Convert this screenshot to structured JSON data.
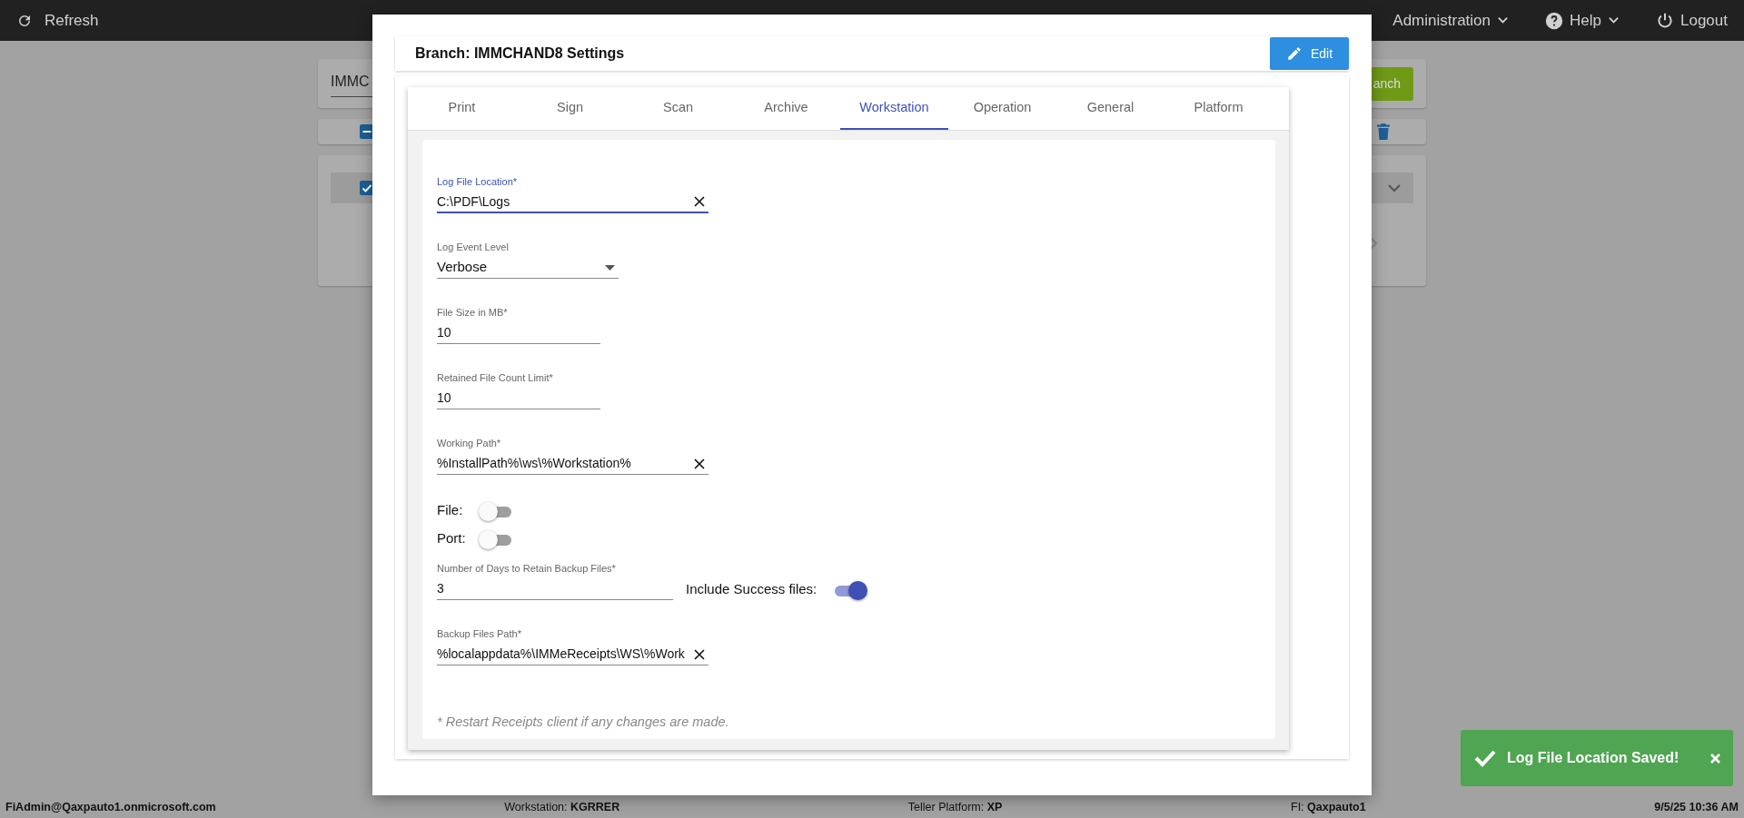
{
  "topbar": {
    "refresh": "Refresh",
    "menus": [
      {
        "kind": "dropdown",
        "label": "Administration"
      },
      {
        "kind": "help",
        "label": "Help"
      },
      {
        "kind": "logout",
        "label": "Logout"
      }
    ]
  },
  "background": {
    "search_value": "IMMC",
    "button": "anch",
    "header_checked": true,
    "row_checked": true
  },
  "modal": {
    "title": "Branch: IMMCHAND8 Settings",
    "edit": "Edit",
    "tabs": [
      {
        "label": "Print",
        "selected": false
      },
      {
        "label": "Sign",
        "selected": false
      },
      {
        "label": "Scan",
        "selected": false
      },
      {
        "label": "Archive",
        "selected": false
      },
      {
        "label": "Workstation",
        "selected": true
      },
      {
        "label": "Operation",
        "selected": false
      },
      {
        "label": "General",
        "selected": false
      },
      {
        "label": "Platform",
        "selected": false
      }
    ],
    "fields": [
      {
        "kind": "text",
        "label": "Log File Location*",
        "value": "C:\\PDF\\Logs",
        "focused": true,
        "clearable": true
      },
      {
        "kind": "select",
        "label": "Log Event Level",
        "value": "Verbose"
      },
      {
        "kind": "text",
        "label": "File Size in MB*",
        "value": "10",
        "focused": false,
        "clearable": false
      },
      {
        "kind": "text",
        "label": "Retained File Count Limit*",
        "value": "10",
        "focused": false,
        "clearable": false
      },
      {
        "kind": "text",
        "label": "Working Path*",
        "value": "%InstallPath%\\ws\\%Workstation%",
        "focused": false,
        "clearable": true
      },
      {
        "kind": "toggle",
        "label": "File:",
        "on": false
      },
      {
        "kind": "toggle",
        "label": "Port:",
        "on": false
      },
      {
        "kind": "text",
        "label": "Number of Days to Retain Backup Files*",
        "value": "3",
        "focused": false,
        "clearable": false,
        "side_toggle": {
          "label": "Include Success files:",
          "on": true
        }
      },
      {
        "kind": "text",
        "label": "Backup Files Path*",
        "value": "%localappdata%\\IMMeReceipts\\WS\\%Work",
        "focused": false,
        "clearable": true
      }
    ],
    "note": "* Restart Receipts client if any changes are made."
  },
  "toast": {
    "message": "Log File Location Saved!"
  },
  "footer": [
    {
      "value": "FiAdmin@Qaxpauto1.onmicrosoft.com"
    },
    {
      "label": "Workstation:",
      "value": "KGRRER"
    },
    {
      "label": "Teller Platform:",
      "value": "XP"
    },
    {
      "label": "FI:",
      "value": "Qaxpauto1"
    },
    {
      "value": "9/5/25 10:36 AM"
    }
  ]
}
